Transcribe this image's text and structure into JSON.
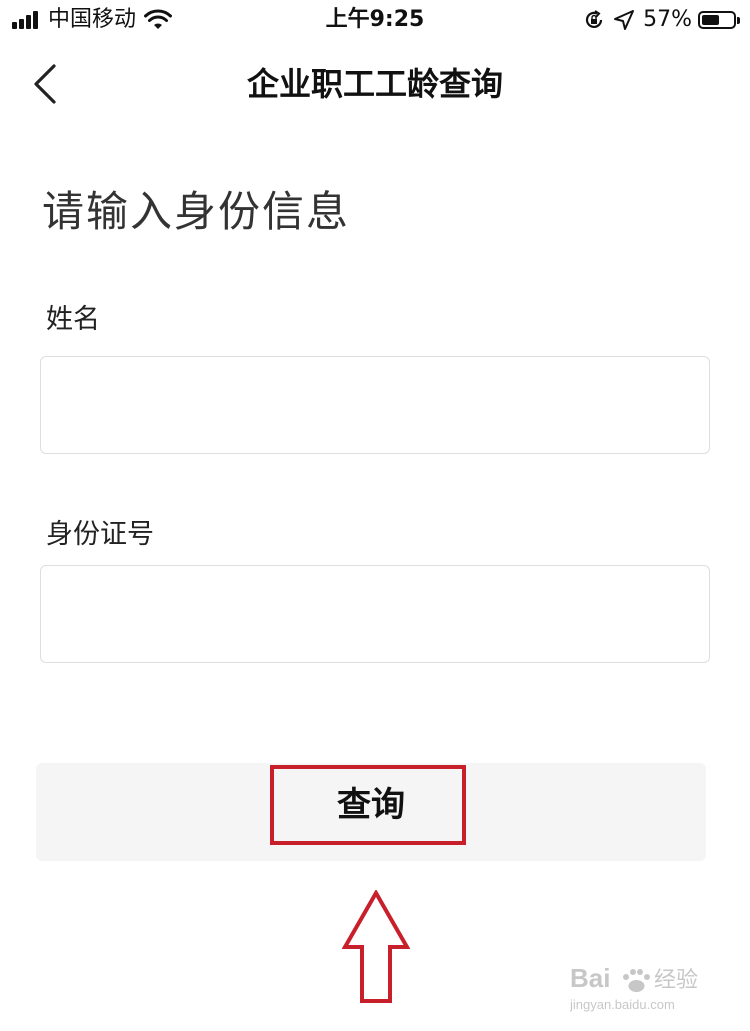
{
  "status_bar": {
    "carrier": "中国移动",
    "time": "上午9:25",
    "battery_percent": "57%",
    "battery_level": 0.57,
    "icons": [
      "signal-icon",
      "wifi-icon",
      "rotation-lock-icon",
      "location-icon",
      "battery-icon"
    ]
  },
  "nav": {
    "title": "企业职工工龄查询",
    "back_icon": "chevron-left-icon"
  },
  "form": {
    "heading": "请输入身份信息",
    "name_label": "姓名",
    "name_value": "",
    "id_label": "身份证号",
    "id_value": ""
  },
  "query_button": {
    "label": "查询"
  },
  "annotation": {
    "highlight_color": "#c8202b",
    "arrow_icon": "up-arrow-icon"
  },
  "watermark": {
    "text": "Baidu经验",
    "url": "jingyan.baidu.com"
  }
}
